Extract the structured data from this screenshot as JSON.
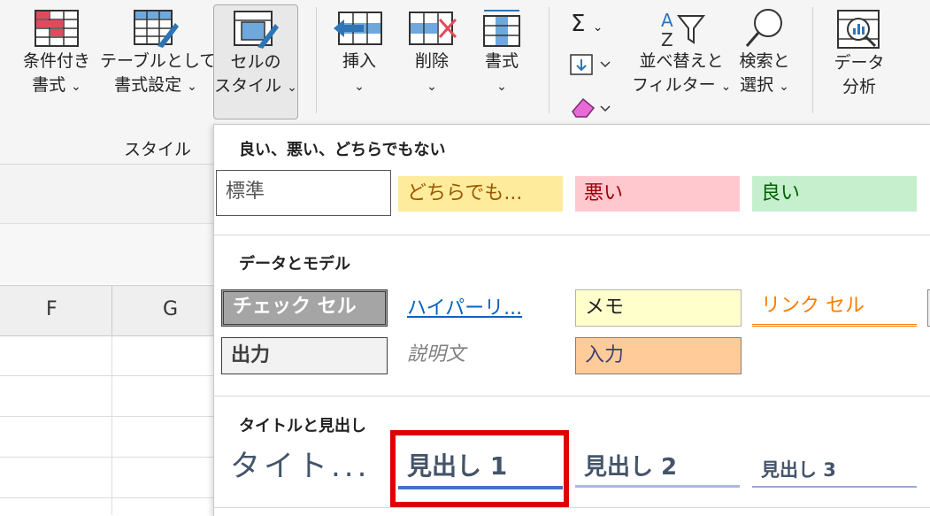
{
  "ribbon": {
    "conditional_format": {
      "line1": "条件付き",
      "line2": "書式"
    },
    "format_as_table": {
      "line1": "テーブルとして",
      "line2": "書式設定"
    },
    "cell_styles": {
      "line1": "セルの",
      "line2": "スタイル"
    },
    "insert": {
      "label": "挿入"
    },
    "delete": {
      "label": "削除"
    },
    "format": {
      "label": "書式"
    },
    "autosum_symbol": "Σ",
    "sort_filter": {
      "line1": "並べ替えと",
      "line2": "フィルター"
    },
    "find_select": {
      "line1": "検索と",
      "line2": "選択"
    },
    "analyze_data": {
      "line1": "データ",
      "line2": "分析"
    },
    "styles_group_label": "スタイル",
    "chevron": "⌄"
  },
  "sheet": {
    "columns": [
      "F",
      "G"
    ]
  },
  "gallery": {
    "sections": {
      "good_bad": "良い、悪い、どちらでもない",
      "data_model": "データとモデル",
      "titles": "タイトルと見出し"
    },
    "good_bad": {
      "normal": "標準",
      "neutral": "どちらでも...",
      "bad": "悪い",
      "good": "良い"
    },
    "data_model": {
      "check_cell": "チェック セル",
      "hyperlink": "ハイパーリ...",
      "note": "メモ",
      "linked_cell": "リンク セル",
      "output": "出力",
      "explanatory": "説明文",
      "input": "入力"
    },
    "titles": {
      "title": "タイト...",
      "heading1": "見出し 1",
      "heading2": "見出し 2",
      "heading3": "見出し 3"
    }
  },
  "colors": {
    "neutral_bg": "#ffeb9c",
    "neutral_fg": "#9c5700",
    "bad_bg": "#ffc7ce",
    "bad_fg": "#9c0006",
    "good_bg": "#c6efce",
    "good_fg": "#006100",
    "check_bg": "#a5a5a5",
    "note_bg": "#ffffcc",
    "input_bg": "#ffcc99",
    "input_fg": "#3f3f76",
    "output_bg": "#f2f2f2",
    "linked_fg": "#fa7d00",
    "hyperlink_fg": "#0563c1",
    "heading_fg": "#44546a",
    "heading_line": "#4472c4",
    "highlight": "#e00000"
  }
}
